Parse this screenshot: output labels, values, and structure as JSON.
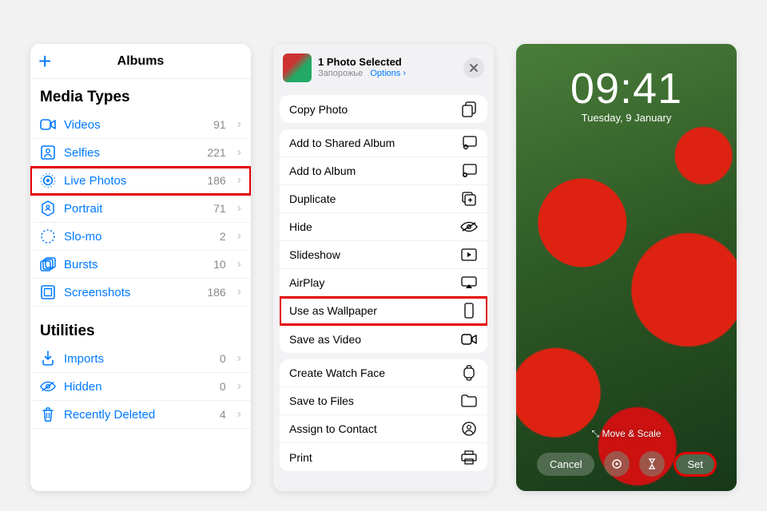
{
  "left": {
    "header": "Albums",
    "mediaTitle": "Media Types",
    "utilitiesTitle": "Utilities",
    "media": [
      {
        "icon": "video-icon",
        "label": "Videos",
        "count": "91",
        "hl": false
      },
      {
        "icon": "selfies-icon",
        "label": "Selfies",
        "count": "221",
        "hl": false
      },
      {
        "icon": "livephotos-icon",
        "label": "Live Photos",
        "count": "186",
        "hl": true
      },
      {
        "icon": "portrait-icon",
        "label": "Portrait",
        "count": "71",
        "hl": false
      },
      {
        "icon": "slomo-icon",
        "label": "Slo-mo",
        "count": "2",
        "hl": false
      },
      {
        "icon": "bursts-icon",
        "label": "Bursts",
        "count": "10",
        "hl": false
      },
      {
        "icon": "screenshots-icon",
        "label": "Screenshots",
        "count": "186",
        "hl": false
      }
    ],
    "utilities": [
      {
        "icon": "imports-icon",
        "label": "Imports",
        "count": "0"
      },
      {
        "icon": "hidden-icon",
        "label": "Hidden",
        "count": "0"
      },
      {
        "icon": "trash-icon",
        "label": "Recently Deleted",
        "count": "4"
      }
    ]
  },
  "middle": {
    "title": "1 Photo Selected",
    "subtitle": "Запорожье",
    "optionsLabel": "Options",
    "groups": [
      [
        {
          "label": "Copy Photo",
          "icon": "copy-icon",
          "hl": false
        }
      ],
      [
        {
          "label": "Add to Shared Album",
          "icon": "sharedalbum-icon",
          "hl": false
        },
        {
          "label": "Add to Album",
          "icon": "addalbum-icon",
          "hl": false
        },
        {
          "label": "Duplicate",
          "icon": "duplicate-icon",
          "hl": false
        },
        {
          "label": "Hide",
          "icon": "hide-icon",
          "hl": false
        },
        {
          "label": "Slideshow",
          "icon": "slideshow-icon",
          "hl": false
        },
        {
          "label": "AirPlay",
          "icon": "airplay-icon",
          "hl": false
        },
        {
          "label": "Use as Wallpaper",
          "icon": "wallpaper-icon",
          "hl": true
        },
        {
          "label": "Save as Video",
          "icon": "savevideo-icon",
          "hl": false
        }
      ],
      [
        {
          "label": "Create Watch Face",
          "icon": "watchface-icon",
          "hl": false
        },
        {
          "label": "Save to Files",
          "icon": "files-icon",
          "hl": false
        },
        {
          "label": "Assign to Contact",
          "icon": "contact-icon",
          "hl": false
        },
        {
          "label": "Print",
          "icon": "print-icon",
          "hl": false
        }
      ]
    ]
  },
  "right": {
    "time": "09:41",
    "date": "Tuesday, 9 January",
    "moveScale": "⤡  Move & Scale",
    "cancel": "Cancel",
    "set": "Set"
  }
}
